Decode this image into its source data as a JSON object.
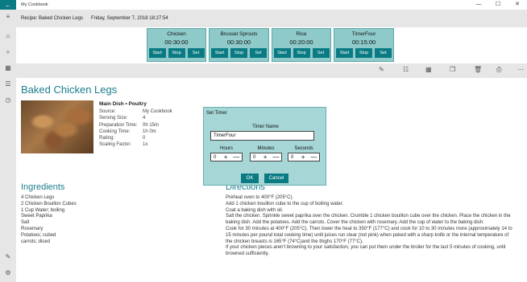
{
  "window": {
    "title": "My Cookbook",
    "controls": [
      "—",
      "☐",
      "✕"
    ]
  },
  "header": {
    "recipe_label": "Recipe: Baked Chicken Legs",
    "date": "Friday, September 7, 2018 18:27:54"
  },
  "timers": [
    {
      "name": "Chicken",
      "time": "00:30:00"
    },
    {
      "name": "Brussel Sprouts",
      "time": "00:30:00"
    },
    {
      "name": "Rice",
      "time": "00:20:00"
    },
    {
      "name": "TimerFour",
      "time": "00:15:00"
    }
  ],
  "timer_buttons": {
    "start": "Start",
    "stop": "Stop",
    "set": "Set"
  },
  "recipe": {
    "title": "Baked Chicken Legs",
    "category": "Main Dish  •  Poultry",
    "info": [
      {
        "key": "Source:",
        "value": "My Cookbook"
      },
      {
        "key": "Serving Size:",
        "value": "4"
      },
      {
        "key": "Preparation Time:",
        "value": "0h 15m"
      },
      {
        "key": "Cooking Time:",
        "value": "1h 0m"
      },
      {
        "key": "Rating:",
        "value": "0"
      },
      {
        "key": "Scaling Factor:",
        "value": "1x"
      }
    ],
    "ingredients_heading": "Ingredients",
    "ingredients": [
      "4 Chicken Legs",
      "2 Chicken Bouillon Cubes",
      "1 Cup Water; boiling",
      "Sweet Paprika",
      "Salt",
      "Rosemary",
      "Potatoes; cubed",
      "carrots; diced"
    ],
    "directions_heading": "Directions",
    "directions": [
      "Preheat oven to 400°F (205°C).",
      "Add 1 chicken bouillon cube to the cup of boiling water.",
      "Coat a baking dish with oil.",
      "Salt the chicken. Sprinkle sweet paprika over the chicken. Crumble 1 chicken bouillon cube over the chicken. Place the chicken in the baking dish. Add the potatoes. Add the carrots. Cover the chicken with rosemary. Add the cup of water to the baking dish.",
      "Cook for 30 minutes at 400°F (205°C). Then lower the heat to 350°F (177°C) and cook for 10 to 30 minutes more (approximately 14 to 15 minutes per pound total cooking time) until juices run clear (not pink) when poked with a sharp knife or the internal temperature of the chicken breasts is 165°F (74°C)and the thighs 170°F (77°C).",
      "If your chicken pieces aren't browning to your satisfaction, you can put them under the broiler for the last 5 minutes of cooking, until browned sufficiently."
    ]
  },
  "dialog": {
    "title": "Set Timer",
    "name_label": "Timer Name",
    "name_value": "TimerFour",
    "hours_label": "Hours",
    "minutes_label": "Minutes",
    "seconds_label": "Seconds",
    "hours_value": "0",
    "minutes_value": "0",
    "seconds_value": "0",
    "plus": "+",
    "minus": "—",
    "ok_label": "OK",
    "cancel_label": "Cancel"
  },
  "colors": {
    "accent": "#0a7b83",
    "timer_bg": "#8fcaca",
    "heading": "#1a7d8c",
    "dialog_bg": "#a6d6d6",
    "chrome": "#e6e6e6"
  },
  "icons": {
    "back": "←",
    "menu": "≡",
    "home": "⌂",
    "search": "⌕",
    "calendar": "▦",
    "list": "☰",
    "timer": "◷",
    "edit": "✎",
    "settings": "⚙",
    "cmd_edit": "✎",
    "cmd_list": "☷",
    "cmd_calendar": "▦",
    "cmd_copy": "❐",
    "cmd_delete": "🗑",
    "cmd_print": "⎙",
    "cmd_more": "⋯"
  }
}
